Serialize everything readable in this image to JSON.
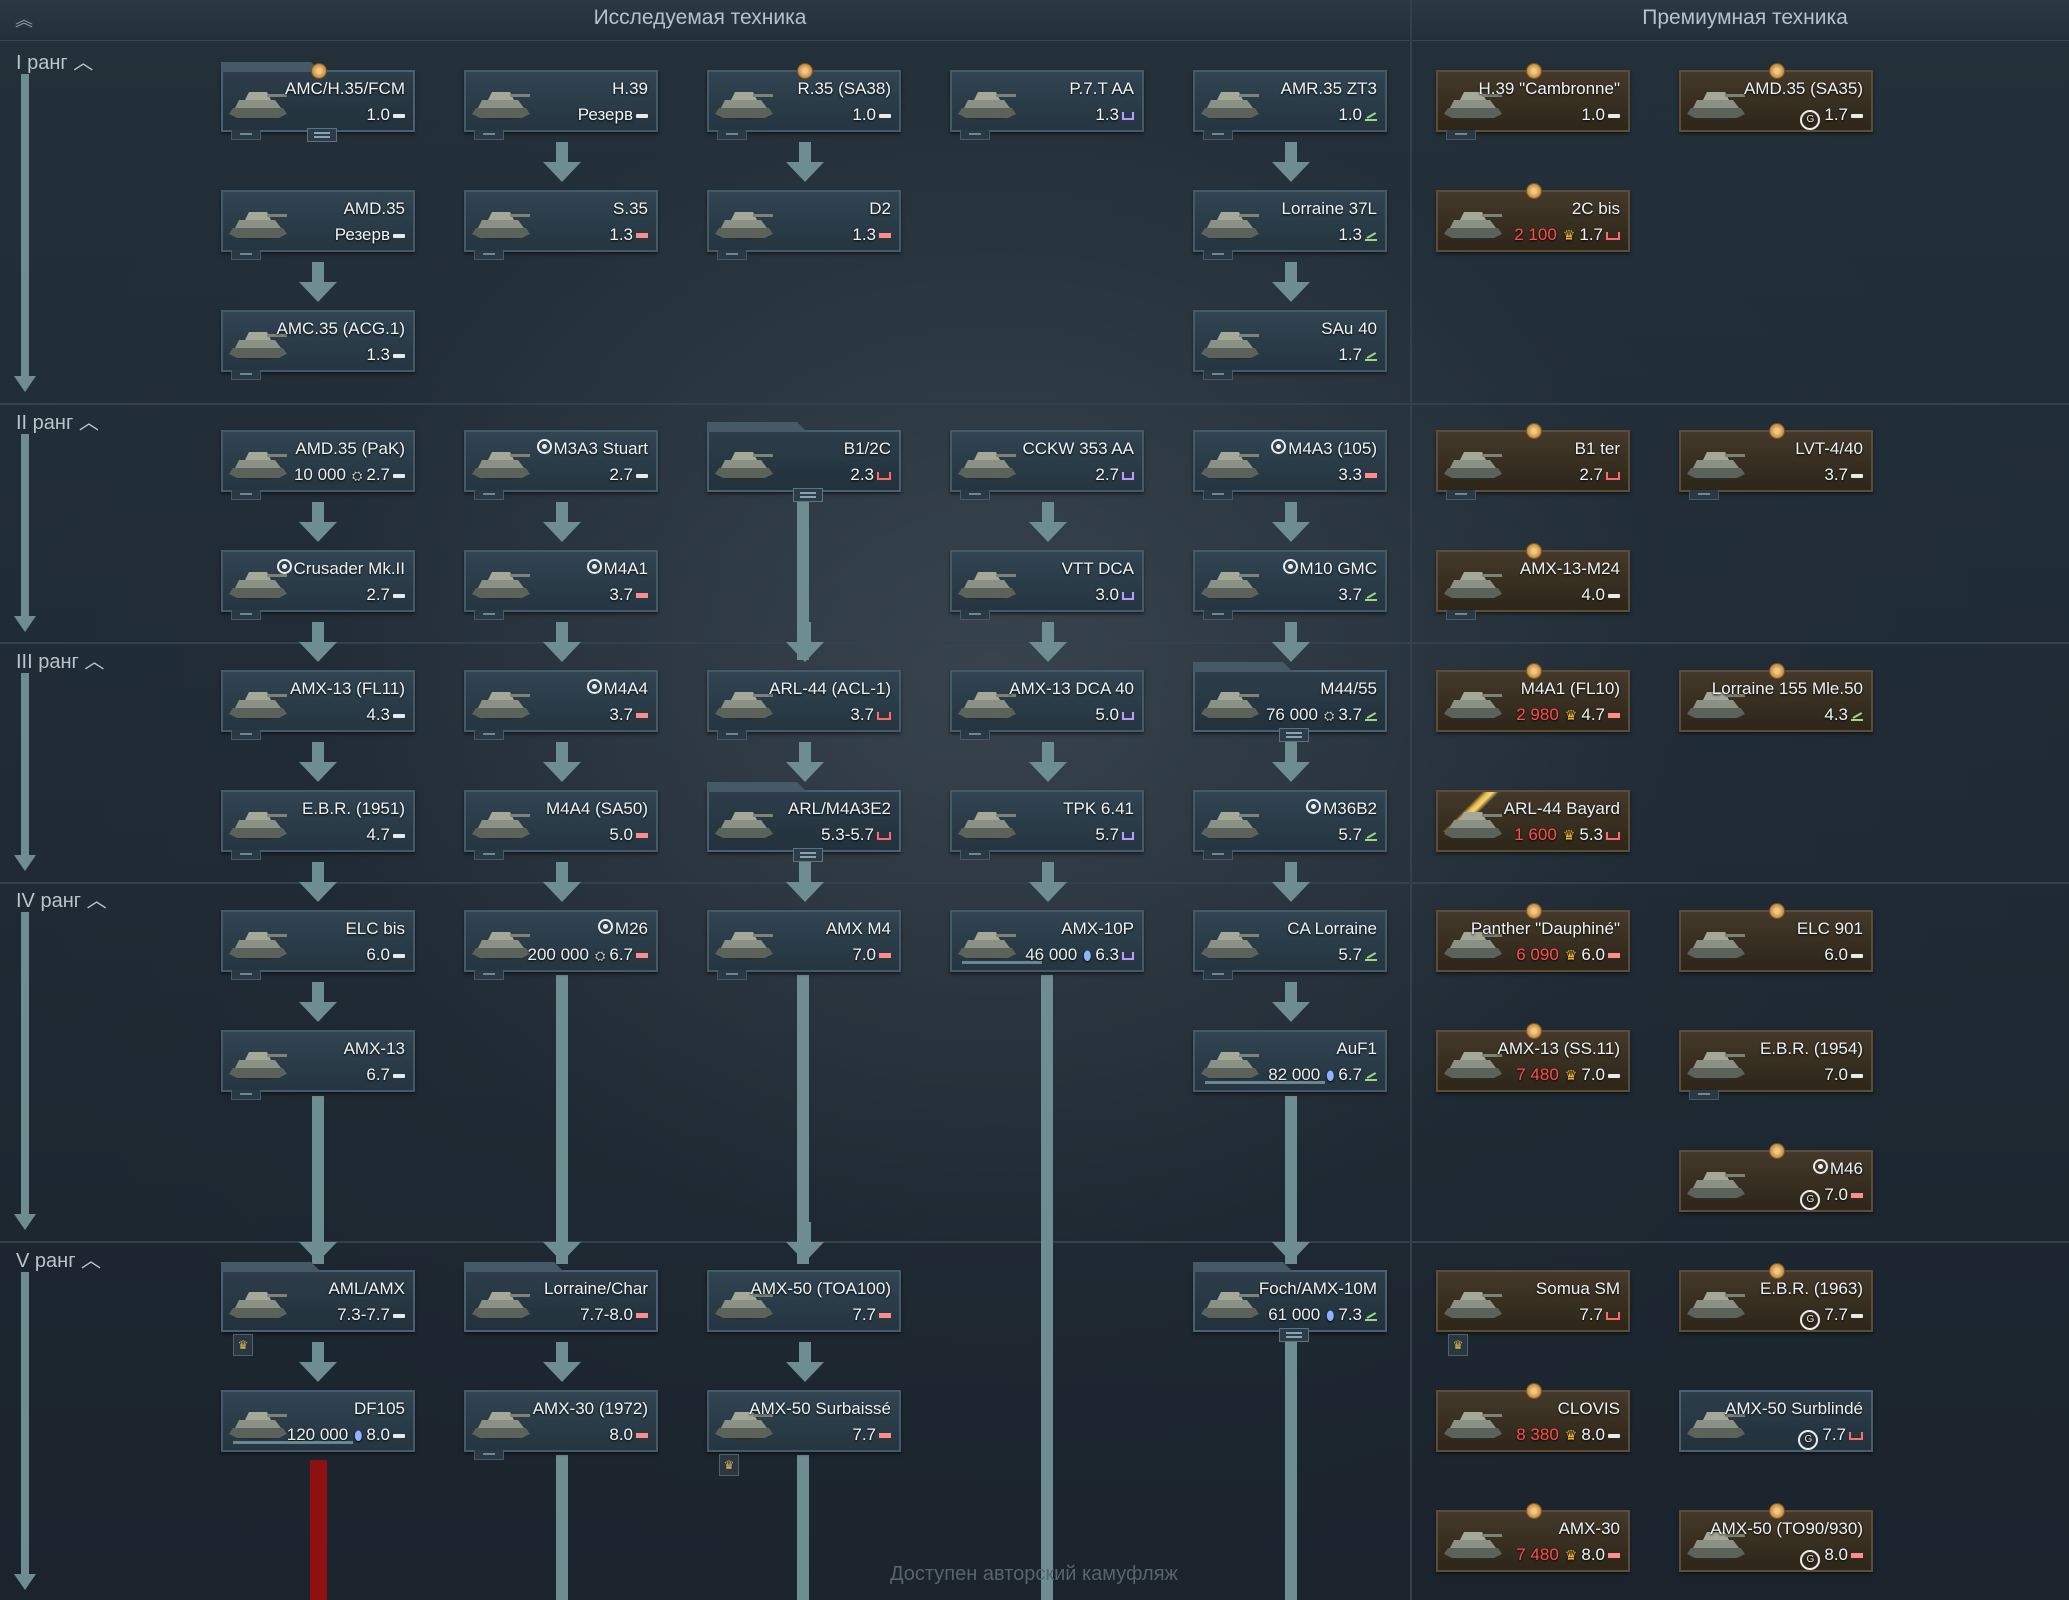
{
  "header": {
    "researched_title": "Исследуемая техника",
    "premium_title": "Премиумная техника",
    "collapse_icon": "double-chevron-up-icon"
  },
  "ranks": [
    {
      "label": "I ранг"
    },
    {
      "label": "II ранг"
    },
    {
      "label": "III ранг"
    },
    {
      "label": "IV ранг"
    },
    {
      "label": "V ранг"
    }
  ],
  "notice": "Доступен авторский камуфляж",
  "vehicles": {
    "r1": [
      {
        "name": "AMC/H.35/FCM",
        "br": "1.0",
        "cls": "light"
      },
      {
        "name": "H.39",
        "br": "Резерв",
        "cls": "light"
      },
      {
        "name": "R.35 (SA38)",
        "br": "1.0",
        "cls": "light"
      },
      {
        "name": "P.7.T AA",
        "br": "1.3",
        "cls": "aa"
      },
      {
        "name": "AMR.35 ZT3",
        "br": "1.0",
        "cls": "spg"
      },
      {
        "name": "AMD.35",
        "br": "Резерв",
        "cls": "light"
      },
      {
        "name": "S.35",
        "br": "1.3",
        "cls": "medium"
      },
      {
        "name": "D2",
        "br": "1.3",
        "cls": "medium"
      },
      {
        "name": "Lorraine 37L",
        "br": "1.3",
        "cls": "spg"
      },
      {
        "name": "AMC.35 (ACG.1)",
        "br": "1.3",
        "cls": "light"
      },
      {
        "name": "SAu 40",
        "br": "1.7",
        "cls": "spg"
      }
    ],
    "r2": [
      {
        "name": "AMD.35 (PaK)",
        "cost": "10 000",
        "br": "2.7",
        "cls": "light"
      },
      {
        "name": "M3A3 Stuart",
        "br": "2.7",
        "cls": "light"
      },
      {
        "name": "B1/2C",
        "br": "2.3",
        "cls": "heavy"
      },
      {
        "name": "CCKW 353 AA",
        "br": "2.7",
        "cls": "aa"
      },
      {
        "name": "M4A3 (105)",
        "br": "3.3",
        "cls": "medium"
      },
      {
        "name": "Crusader Mk.II",
        "br": "2.7",
        "cls": "light"
      },
      {
        "name": "M4A1",
        "br": "3.7",
        "cls": "medium"
      },
      {
        "name": "VTT DCA",
        "br": "3.0",
        "cls": "aa"
      },
      {
        "name": "M10 GMC",
        "br": "3.7",
        "cls": "spg"
      }
    ],
    "r3": [
      {
        "name": "AMX-13 (FL11)",
        "br": "4.3",
        "cls": "light"
      },
      {
        "name": "M4A4",
        "br": "3.7",
        "cls": "medium"
      },
      {
        "name": "ARL-44 (ACL-1)",
        "br": "3.7",
        "cls": "heavy"
      },
      {
        "name": "AMX-13 DCA 40",
        "br": "5.0",
        "cls": "aa"
      },
      {
        "name": "M44/55",
        "cost": "76 000",
        "br": "3.7",
        "cls": "spg"
      },
      {
        "name": "E.B.R. (1951)",
        "br": "4.7",
        "cls": "light"
      },
      {
        "name": "M4A4 (SA50)",
        "br": "5.0",
        "cls": "medium"
      },
      {
        "name": "ARL/M4A3E2",
        "br": "5.3-5.7",
        "cls": "heavy"
      },
      {
        "name": "TPK 6.41",
        "br": "5.7",
        "cls": "aa"
      },
      {
        "name": "M36B2",
        "br": "5.7",
        "cls": "spg"
      }
    ],
    "r4": [
      {
        "name": "ELC bis",
        "br": "6.0",
        "cls": "light"
      },
      {
        "name": "M26",
        "cost": "200 000",
        "br": "6.7",
        "cls": "medium"
      },
      {
        "name": "AMX M4",
        "br": "7.0",
        "cls": "medium"
      },
      {
        "name": "AMX-10P",
        "cost": "46 000",
        "br": "6.3",
        "cls": "aa"
      },
      {
        "name": "CA Lorraine",
        "br": "5.7",
        "cls": "spg"
      },
      {
        "name": "AMX-13",
        "br": "6.7",
        "cls": "light"
      },
      {
        "name": "AuF1",
        "cost": "82 000",
        "br": "6.7",
        "cls": "spg"
      }
    ],
    "r5": [
      {
        "name": "AML/AMX",
        "br": "7.3-7.7",
        "cls": "light"
      },
      {
        "name": "Lorraine/Char",
        "br": "7.7-8.0",
        "cls": "medium"
      },
      {
        "name": "AMX-50 (TOA100)",
        "br": "7.7",
        "cls": "medium"
      },
      {
        "name": "Foch/AMX-10M",
        "cost": "61 000",
        "br": "7.3",
        "cls": "spg"
      },
      {
        "name": "DF105",
        "cost": "120 000",
        "br": "8.0",
        "cls": "light"
      },
      {
        "name": "AMX-30 (1972)",
        "br": "8.0",
        "cls": "medium"
      },
      {
        "name": "AMX-50 Surbaissé",
        "br": "7.7",
        "cls": "medium"
      }
    ],
    "premium": [
      {
        "name": "H.39 \"Cambronne\"",
        "br": "1.0",
        "cls": "light"
      },
      {
        "name": "AMD.35 (SA35)",
        "br": "1.7",
        "cls": "light"
      },
      {
        "name": "2C bis",
        "cost": "2 100",
        "br": "1.7",
        "cls": "heavy"
      },
      {
        "name": "B1 ter",
        "br": "2.7",
        "cls": "heavy"
      },
      {
        "name": "LVT-4/40",
        "br": "3.7",
        "cls": "light"
      },
      {
        "name": "AMX-13-M24",
        "br": "4.0",
        "cls": "light"
      },
      {
        "name": "M4A1 (FL10)",
        "cost": "2 980",
        "br": "4.7",
        "cls": "medium"
      },
      {
        "name": "Lorraine 155 Mle.50",
        "br": "4.3",
        "cls": "spg"
      },
      {
        "name": "ARL-44 Bayard",
        "cost": "1 600",
        "br": "5.3",
        "cls": "heavy"
      },
      {
        "name": "Panther \"Dauphiné\"",
        "cost": "6 090",
        "br": "6.0",
        "cls": "medium"
      },
      {
        "name": "ELC 901",
        "br": "6.0",
        "cls": "light"
      },
      {
        "name": "AMX-13 (SS.11)",
        "cost": "7 480",
        "br": "7.0",
        "cls": "light"
      },
      {
        "name": "E.B.R. (1954)",
        "br": "7.0",
        "cls": "light"
      },
      {
        "name": "M46",
        "br": "7.0",
        "cls": "medium"
      },
      {
        "name": "Somua SM",
        "br": "7.7",
        "cls": "heavy"
      },
      {
        "name": "E.B.R. (1963)",
        "br": "7.7",
        "cls": "light"
      },
      {
        "name": "CLOVIS",
        "cost": "8 380",
        "br": "8.0",
        "cls": "light"
      },
      {
        "name": "AMX-50 Surblindé",
        "br": "7.7",
        "cls": "heavy"
      },
      {
        "name": "AMX-30",
        "cost": "7 480",
        "br": "8.0",
        "cls": "medium"
      },
      {
        "name": "AMX-50 (TO90/930)",
        "br": "8.0",
        "cls": "medium"
      }
    ]
  }
}
